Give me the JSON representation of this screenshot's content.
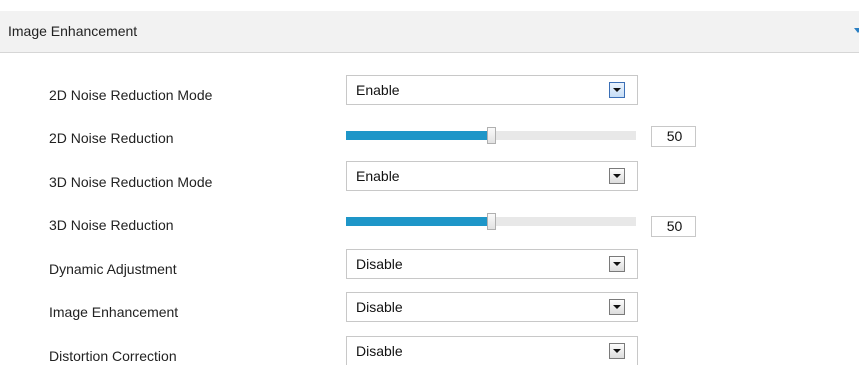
{
  "section": {
    "title": "Image Enhancement",
    "collapse_icon": "chevron-down-icon",
    "accent_color": "#1e96c8"
  },
  "rows": {
    "nr2d_mode": {
      "label": "2D Noise Reduction Mode",
      "value": "Enable"
    },
    "nr2d_level": {
      "label": "2D Noise Reduction",
      "value": "50",
      "fraction": 0.5
    },
    "nr3d_mode": {
      "label": "3D Noise Reduction Mode",
      "value": "Enable"
    },
    "nr3d_level": {
      "label": "3D Noise Reduction",
      "value": "50",
      "fraction": 0.5
    },
    "dynamic_adjustment": {
      "label": "Dynamic Adjustment",
      "value": "Disable"
    },
    "image_enhancement": {
      "label": "Image Enhancement",
      "value": "Disable"
    },
    "distortion_correction": {
      "label": "Distortion Correction",
      "value": "Disable"
    }
  }
}
